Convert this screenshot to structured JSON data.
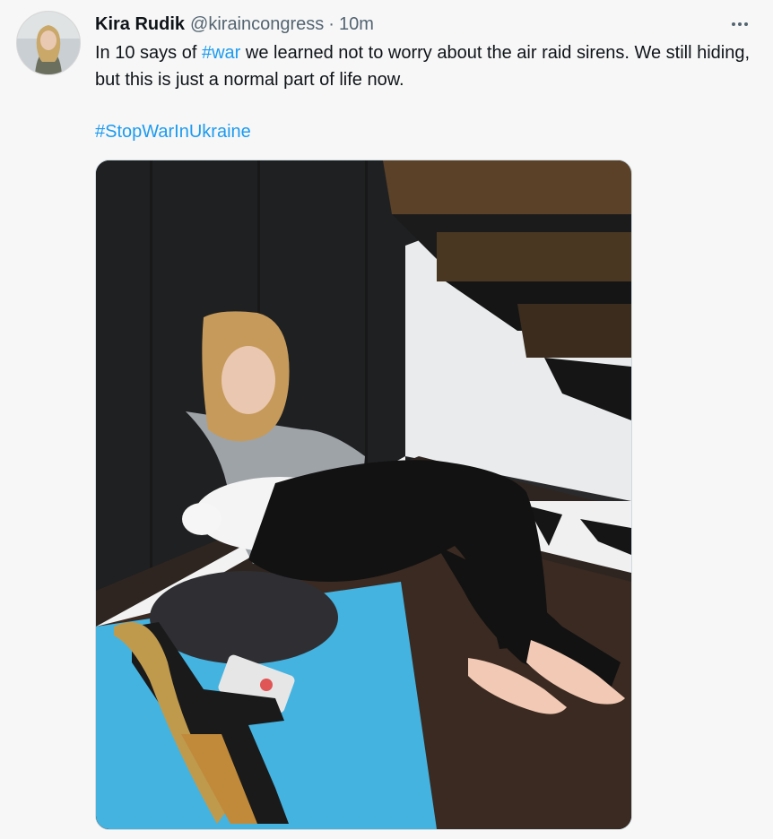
{
  "tweet": {
    "author_name": "Kira Rudik",
    "handle": "@kiraincongress",
    "separator": "·",
    "time": "10m",
    "text_before_link": "In 10 says of ",
    "link_war": "#war",
    "text_after_link": " we learned not to worry about the air raid sirens. We still hiding, but this is just a normal part of life now.",
    "hashtag": "#StopWarInUkraine"
  },
  "colors": {
    "link": "#1d9bf0",
    "background": "#f7f7f7",
    "secondary_text": "#536471"
  },
  "icons": {
    "more": "more-horizontal-icon"
  }
}
